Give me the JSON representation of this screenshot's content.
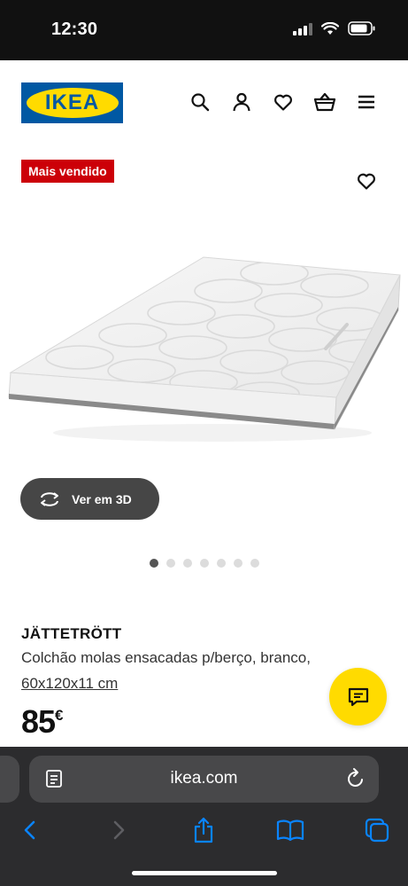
{
  "status_bar": {
    "time": "12:30"
  },
  "header": {
    "logo_text": "IKEA",
    "icons": [
      "search-icon",
      "profile-icon",
      "heart-icon",
      "basket-icon",
      "menu-icon"
    ]
  },
  "gallery": {
    "badge": "Mais vendido",
    "view_3d_label": "Ver em 3D",
    "image_count": 7,
    "active_image": 1
  },
  "product": {
    "name": "JÄTTETRÖTT",
    "description": "Colchão molas ensacadas p/berço, branco,",
    "size": "60x120x11 cm",
    "price": "85",
    "currency": "€"
  },
  "browser": {
    "url": "ikea.com"
  },
  "colors": {
    "ikea_blue": "#0058A3",
    "ikea_yellow": "#FFDB00",
    "badge_red": "#CC0008",
    "safari_blue": "#0A84FF"
  }
}
